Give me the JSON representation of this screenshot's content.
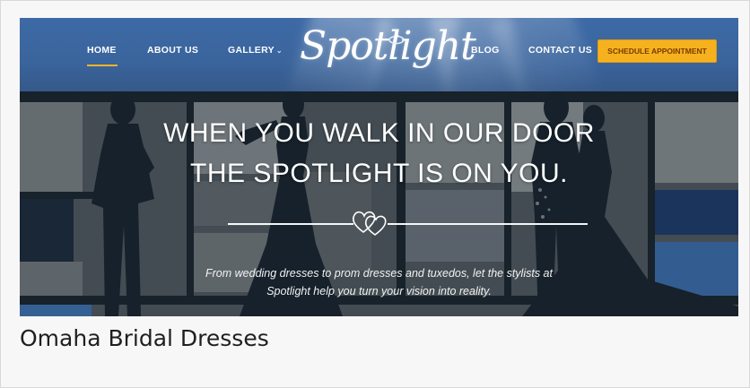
{
  "nav": {
    "items": [
      {
        "label": "HOME",
        "active": true
      },
      {
        "label": "ABOUT US"
      },
      {
        "label": "GALLERY",
        "has_dropdown": true
      },
      {
        "label": "BLOG"
      },
      {
        "label": "CONTACT US"
      }
    ],
    "dropdown_icon": "chevron-down-icon",
    "logo_text": "Spotlight",
    "cta_label": "SCHEDULE APPOINTMENT"
  },
  "hero": {
    "headline_line1": "WHEN YOU WALK IN OUR DOOR",
    "headline_line2": "THE SPOTLIGHT IS ON YOU.",
    "divider_icon": "hearts-icon",
    "tagline_line1": "From wedding dresses to prom dresses and tuxedos, let the stylists at",
    "tagline_line2": "Spotlight help you turn your vision into reality."
  },
  "page": {
    "heading": "Omaha Bridal Dresses"
  },
  "colors": {
    "nav_background": "#3a649c",
    "accent_underline": "#f2b52a",
    "cta_background": "#f5b21e",
    "cta_text": "#7a3b00",
    "hero_overlay": "#4d575e",
    "page_background": "#f7f7f7"
  }
}
